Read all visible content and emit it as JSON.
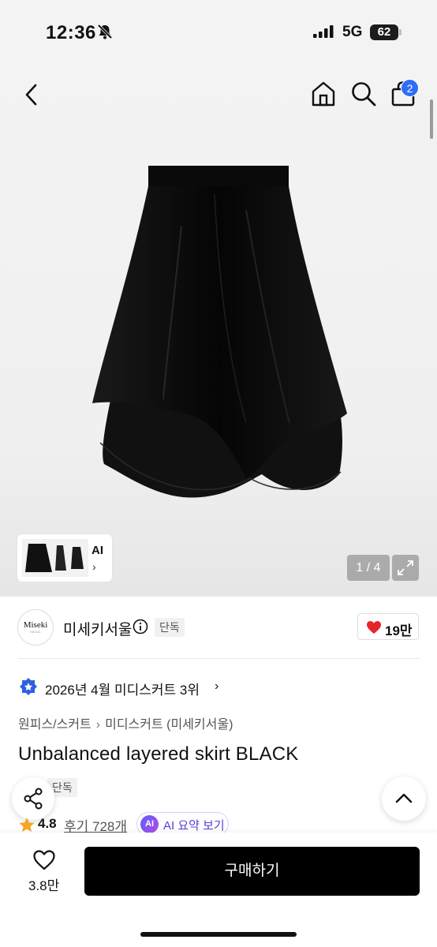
{
  "status_bar": {
    "time": "12:36",
    "network": "5G",
    "battery": "62"
  },
  "top_nav": {
    "cart_count": "2"
  },
  "gallery": {
    "thumb_ai_label": "AI",
    "thumb_chevron": "›",
    "pager": "1 / 4"
  },
  "brand": {
    "logo_text": "Miseki",
    "logo_subtext": "SEOUL",
    "name": "미세키서울",
    "exclusive_badge": "단독",
    "like_count": "19만"
  },
  "ranking": {
    "text": "2026년 4월 미디스커트 3위",
    "chevron": "›"
  },
  "breadcrumb": [
    "원피스/스커트",
    "미디스커트 (미세키서울)"
  ],
  "breadcrumb_sep": "›",
  "product": {
    "title": "Unbalanced layered skirt BLACK",
    "exclusive_badge": "단독",
    "rating": "4.8",
    "reviews": "후기 728개",
    "ai_badge": "AI",
    "ai_summary": "AI 요약 보기"
  },
  "bottom_bar": {
    "wish_count": "3.8만",
    "buy_label": "구매하기"
  },
  "icons": [
    "back-icon",
    "home-icon",
    "search-icon",
    "bag-icon",
    "info-icon",
    "heart-icon",
    "rank-badge-icon",
    "share-icon",
    "chevron-up-icon",
    "star-icon",
    "expand-icon",
    "bell-off-icon",
    "signal-icon"
  ],
  "colors": {
    "accent_blue": "#2f6df6",
    "heart_red": "#e5252a",
    "star_orange": "#f5a623",
    "ai_purple": "#5a3fd6",
    "buy_black": "#000000"
  }
}
